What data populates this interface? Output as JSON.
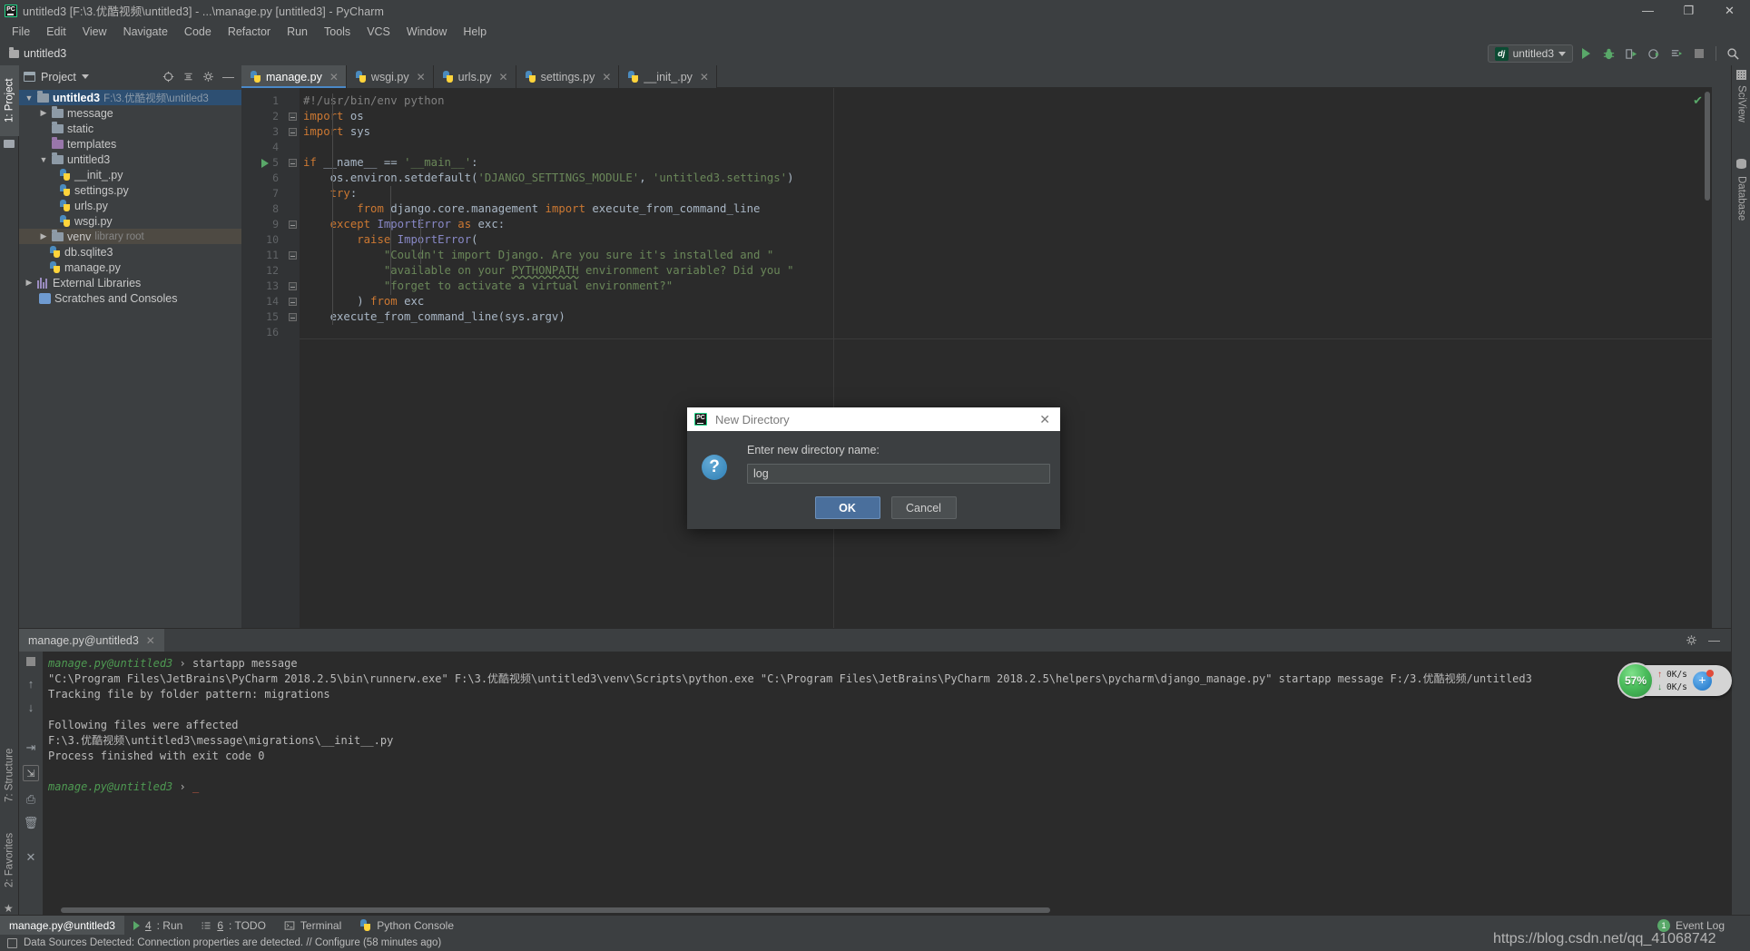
{
  "window": {
    "title": "untitled3 [F:\\3.优酷视频\\untitled3] - ...\\manage.py [untitled3] - PyCharm",
    "logo": "pycharm-logo",
    "minimize": "—",
    "maximize": "❐",
    "close": "✕"
  },
  "menu": {
    "items": [
      "File",
      "Edit",
      "View",
      "Navigate",
      "Code",
      "Refactor",
      "Run",
      "Tools",
      "VCS",
      "Window",
      "Help"
    ]
  },
  "toolbar": {
    "breadcrumb": "untitled3",
    "run_config": "untitled3",
    "run_config_badge": "dj",
    "icons": [
      "run-icon",
      "debug-icon",
      "run-coverage-icon",
      "profile-icon",
      "run-with-console-icon",
      "stop-icon",
      "search-everywhere-icon"
    ]
  },
  "left_strip": {
    "top": [
      {
        "label": "1: Project",
        "active": true
      }
    ],
    "bottom": [
      {
        "label": "7: Structure",
        "active": false
      },
      {
        "label": "2: Favorites",
        "active": false
      }
    ]
  },
  "right_strip": {
    "items": [
      {
        "label": "SciView"
      },
      {
        "label": "Database"
      }
    ]
  },
  "project": {
    "title": "Project",
    "header_icons": [
      "target-icon",
      "collapse-all-icon",
      "gear-icon",
      "hide-icon"
    ],
    "tree": [
      {
        "level": 0,
        "arrow": "▼",
        "icon": "folder-icon",
        "label": "untitled3",
        "suffix": "F:\\3.优酷视频\\untitled3",
        "state": "selected",
        "bold": true
      },
      {
        "level": 1,
        "arrow": "▶",
        "icon": "folder-icon",
        "label": "message",
        "suffix": "",
        "state": ""
      },
      {
        "level": 1,
        "arrow": "",
        "icon": "folder-icon",
        "label": "static",
        "suffix": "",
        "state": ""
      },
      {
        "level": 1,
        "arrow": "",
        "icon": "folder-purple-icon",
        "label": "templates",
        "suffix": "",
        "state": ""
      },
      {
        "level": 1,
        "arrow": "▼",
        "icon": "folder-icon",
        "label": "untitled3",
        "suffix": "",
        "state": ""
      },
      {
        "level": 2,
        "arrow": "",
        "icon": "python-file-icon",
        "label": "__init_.py",
        "suffix": "",
        "state": ""
      },
      {
        "level": 2,
        "arrow": "",
        "icon": "python-file-icon",
        "label": "settings.py",
        "suffix": "",
        "state": ""
      },
      {
        "level": 2,
        "arrow": "",
        "icon": "python-file-icon",
        "label": "urls.py",
        "suffix": "",
        "state": ""
      },
      {
        "level": 2,
        "arrow": "",
        "icon": "python-file-icon",
        "label": "wsgi.py",
        "suffix": "",
        "state": ""
      },
      {
        "level": 1,
        "arrow": "▶",
        "icon": "folder-icon",
        "label": "venv",
        "suffix": "library root",
        "state": "highlight"
      },
      {
        "level": 1,
        "arrow": "",
        "icon": "db-file-icon",
        "label": "db.sqlite3",
        "suffix": "",
        "state": ""
      },
      {
        "level": 1,
        "arrow": "",
        "icon": "python-file-icon",
        "label": "manage.py",
        "suffix": "",
        "state": ""
      },
      {
        "level": 0,
        "arrow": "▶",
        "icon": "libraries-icon",
        "label": "External Libraries",
        "suffix": "",
        "state": ""
      },
      {
        "level": 0,
        "arrow": "",
        "icon": "scratches-icon",
        "label": "Scratches and Consoles",
        "suffix": "",
        "state": ""
      }
    ]
  },
  "editor": {
    "tabs": [
      {
        "label": "manage.py",
        "active": true
      },
      {
        "label": "wsgi.py",
        "active": false
      },
      {
        "label": "urls.py",
        "active": false
      },
      {
        "label": "settings.py",
        "active": false
      },
      {
        "label": "__init_.py",
        "active": false
      }
    ],
    "line_numbers": [
      "1",
      "2",
      "3",
      "4",
      "5",
      "6",
      "7",
      "8",
      "9",
      "10",
      "11",
      "12",
      "13",
      "14",
      "15",
      "16"
    ],
    "lines": [
      "#!/usr/bin/env python",
      "import os",
      "import sys",
      "",
      "if __name__ == '__main__':",
      "    os.environ.setdefault('DJANGO_SETTINGS_MODULE', 'untitled3.settings')",
      "    try:",
      "        from django.core.management import execute_from_command_line",
      "    except ImportError as exc:",
      "        raise ImportError(",
      "            \"Couldn't import Django. Are you sure it's installed and \"",
      "            \"available on your PYTHONPATH environment variable? Did you \"",
      "            \"forget to activate a virtual environment?\"",
      "        ) from exc",
      "    execute_from_command_line(sys.argv)",
      ""
    ]
  },
  "dialog": {
    "title": "New Directory",
    "logo": "pycharm-logo",
    "close": "✕",
    "question_icon": "question-icon",
    "label": "Enter new directory name:",
    "input_value": "log",
    "ok_label": "OK",
    "cancel_label": "Cancel"
  },
  "run_panel": {
    "tab_label": "manage.py@untitled3",
    "tab_close": "✕",
    "tools": [
      "gear-icon",
      "hide-icon"
    ],
    "sidebar_icons": [
      "stop-icon",
      "up-arrow-icon",
      "down-arrow-icon",
      "soft-wrap-icon",
      "scroll-to-end-icon",
      "print-icon",
      "clear-all-icon",
      "close-icon"
    ],
    "console": [
      {
        "type": "cmd",
        "prefix": "manage.py@untitled3",
        "arrow": "›",
        "text": "startapp message"
      },
      {
        "type": "plain",
        "text": "\"C:\\Program Files\\JetBrains\\PyCharm 2018.2.5\\bin\\runnerw.exe\" F:\\3.优酷视频\\untitled3\\venv\\Scripts\\python.exe \"C:\\Program Files\\JetBrains\\PyCharm 2018.2.5\\helpers\\pycharm\\django_manage.py\" startapp message F:/3.优酷视频/untitled3"
      },
      {
        "type": "plain",
        "text": "Tracking file by folder pattern:  migrations"
      },
      {
        "type": "gap",
        "text": ""
      },
      {
        "type": "plain",
        "text": "Following files were affected"
      },
      {
        "type": "plain",
        "text": " F:\\3.优酷视频\\untitled3\\message\\migrations\\__init__.py"
      },
      {
        "type": "plain",
        "text": "Process finished with exit code 0"
      },
      {
        "type": "gap",
        "text": ""
      },
      {
        "type": "cmd",
        "prefix": "manage.py@untitled3",
        "arrow": "›",
        "text": ""
      }
    ]
  },
  "mem_widget": {
    "percent": "57%",
    "upload": "0K/s",
    "download": "0K/s",
    "up_icon": "arrow-up-icon",
    "down_icon": "arrow-down-icon",
    "plus_label": "+"
  },
  "bottom_bar": {
    "items": [
      {
        "label": "manage.py@untitled3",
        "icon": "",
        "active": true,
        "num": ""
      },
      {
        "label": ": Run",
        "icon": "run-icon",
        "active": false,
        "num": "4"
      },
      {
        "label": ": TODO",
        "icon": "todo-icon",
        "active": false,
        "num": "6"
      },
      {
        "label": "Terminal",
        "icon": "terminal-icon",
        "active": false,
        "num": ""
      },
      {
        "label": "Python Console",
        "icon": "python-icon",
        "active": false,
        "num": ""
      }
    ],
    "event_log": "Event Log",
    "event_count": "1"
  },
  "status_bar": {
    "icon": "data-source-icon",
    "text": "Data Sources Detected: Connection properties are detected. // Configure (58 minutes ago)"
  },
  "watermark": {
    "text": "https://blog.csdn.net/qq_41068742"
  },
  "colors": {
    "accent": "#4a88c7",
    "panel": "#3c3f41",
    "editor_bg": "#2b2b2b",
    "selection": "#2d4f72",
    "keyword": "#cc7832",
    "string": "#6a8759",
    "green": "#59a869"
  }
}
